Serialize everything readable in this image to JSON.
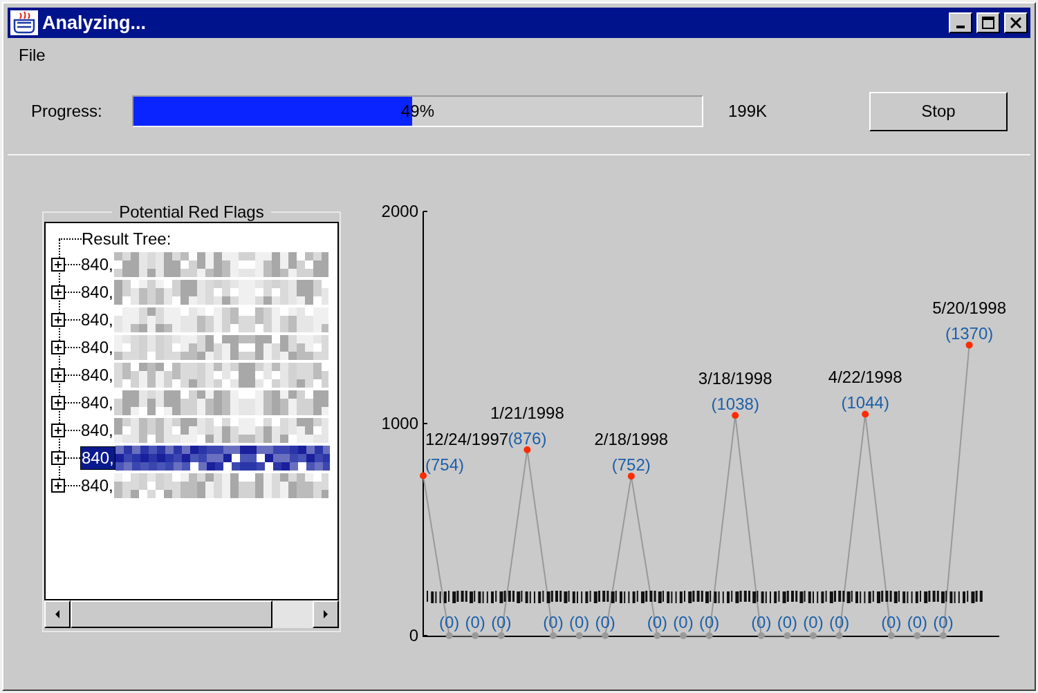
{
  "window": {
    "title": "Analyzing..."
  },
  "menu": [
    {
      "label": "File"
    }
  ],
  "progress": {
    "label": "Progress:",
    "level": 0.49,
    "percent": "49%",
    "size": "199K",
    "button": "Stop"
  },
  "red_flags": {
    "title": "Potential Red Flags",
    "tree": {
      "label": "Result Tree:",
      "children": [
        {
          "label": "840,",
          "expanded": false,
          "selected": false
        },
        {
          "label": "840,",
          "expanded": false,
          "selected": false
        },
        {
          "label": "840,",
          "expanded": false,
          "selected": false
        },
        {
          "label": "840,",
          "expanded": false,
          "selected": false
        },
        {
          "label": "840,",
          "expanded": false,
          "selected": false
        },
        {
          "label": "840,",
          "expanded": false,
          "selected": false
        },
        {
          "label": "840,",
          "expanded": false,
          "selected": false
        },
        {
          "label": "840,",
          "expanded": false,
          "selected": true
        },
        {
          "label": "840,",
          "expanded": false,
          "selected": false
        }
      ]
    }
  },
  "chart": {
    "chart_data": {
      "type": "line",
      "annotations": [
        "12/24/1997",
        "1/21/1998",
        "2/18/1998",
        "3/18/1998",
        "4/22/1998",
        "5/20/1998"
      ],
      "series": [
        {
          "color": "#999999",
          "marker": "circle",
          "values": [
            754,
            0,
            0,
            0,
            876,
            0,
            0,
            0,
            752,
            0,
            0,
            0,
            1038,
            0,
            0,
            0,
            0,
            1044,
            0,
            0,
            0,
            1370
          ]
        }
      ],
      "ylim": [
        0,
        2000
      ],
      "yticks": [
        0,
        1000,
        2000
      ],
      "value_labels": [
        "(754)",
        "(0)",
        "(0)",
        "(0)",
        "(876)",
        "(0)",
        "(0)",
        "(0)",
        "(752)",
        "(0)",
        "(0)",
        "(0)",
        "(1038)",
        "(0)",
        "(0)",
        "(0)",
        "(0)",
        "(1044)",
        "(0)",
        "(0)",
        "(0)",
        "(1370)"
      ]
    }
  }
}
